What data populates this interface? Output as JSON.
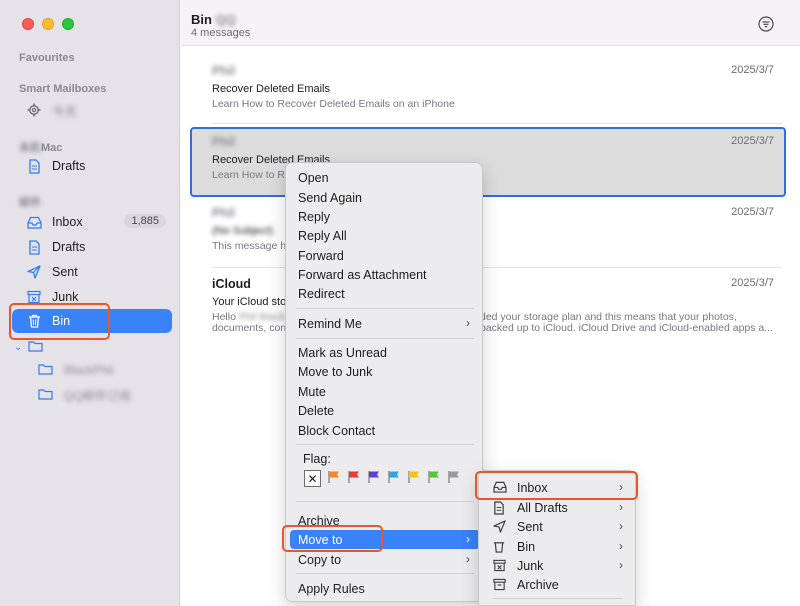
{
  "colors": {
    "accent": "#3a82f7",
    "callout": "#e8572b"
  },
  "sidebar": {
    "favourites": "Favourites",
    "smart_mailboxes": "Smart Mailboxes",
    "smart_item": "今天",
    "mac_head": "Mac",
    "mac_prefix": "本机",
    "mac_drafts": "Drafts",
    "account_head": "邮件",
    "items": [
      {
        "label": "Inbox",
        "icon": "tray-icon",
        "badge": "1,885"
      },
      {
        "label": "Drafts",
        "icon": "document-icon"
      },
      {
        "label": "Sent",
        "icon": "paper-plane-icon"
      },
      {
        "label": "Junk",
        "icon": "junk-box-icon"
      },
      {
        "label": "Bin",
        "icon": "trash-icon",
        "active": true
      }
    ],
    "folders": [
      "BlackPhil",
      "QQ邮件订阅"
    ]
  },
  "header": {
    "title": "Bin",
    "title_blur": "QQ",
    "subtitle": "4 messages",
    "filter_icon": "filter-icon"
  },
  "messages": [
    {
      "sender": "Phil",
      "date": "2025/3/7",
      "subject": "Recover Deleted Emails",
      "preview": "Learn How to Recover Deleted Emails on an iPhone"
    },
    {
      "sender": "Phil",
      "date": "2025/3/7",
      "subject": "Recover Deleted Emails",
      "preview": "Learn How to Re"
    },
    {
      "sender": "Phil",
      "date": "2025/3/7",
      "subject": "(No Subject)",
      "preview": "This message h"
    },
    {
      "sender": "iCloud",
      "date": "2025/3/7",
      "subject": "Your iCloud stor",
      "preview": "Hello",
      "preview_blur": "Phil Black,",
      "preview_a": "ded your storage plan and this means that your photos,",
      "preview_b1": "documents, con",
      "preview_b2": "backed up to iCloud. iCloud Drive and iCloud-enabled apps a..."
    }
  ],
  "context_menu": {
    "group1": [
      "Open",
      "Send Again",
      "Reply",
      "Reply All",
      "Forward",
      "Forward as Attachment",
      "Redirect"
    ],
    "remind": "Remind Me",
    "group2": [
      "Mark as Unread",
      "Move to Junk",
      "Mute",
      "Delete",
      "Block Contact"
    ],
    "flag_label": "Flag:",
    "flag_clear": "✕",
    "flag_colors": [
      "#f0892a",
      "#e83b37",
      "#5a3fd1",
      "#3aa0e0",
      "#f2c318",
      "#5cc43a",
      "#9a979d"
    ],
    "archive": "Archive",
    "move_to": "Move to",
    "copy_to": "Copy to",
    "apply_rules": "Apply Rules"
  },
  "submenu": [
    {
      "label": "Inbox",
      "icon": "tray-icon",
      "chevron": true
    },
    {
      "label": "All Drafts",
      "icon": "document-icon",
      "chevron": true
    },
    {
      "label": "Sent",
      "icon": "paper-plane-icon",
      "chevron": true
    },
    {
      "label": "Bin",
      "icon": "trash-icon",
      "chevron": true
    },
    {
      "label": "Junk",
      "icon": "junk-box-icon",
      "chevron": true
    },
    {
      "label": "Archive",
      "icon": "archive-box-icon",
      "chevron": false
    }
  ]
}
